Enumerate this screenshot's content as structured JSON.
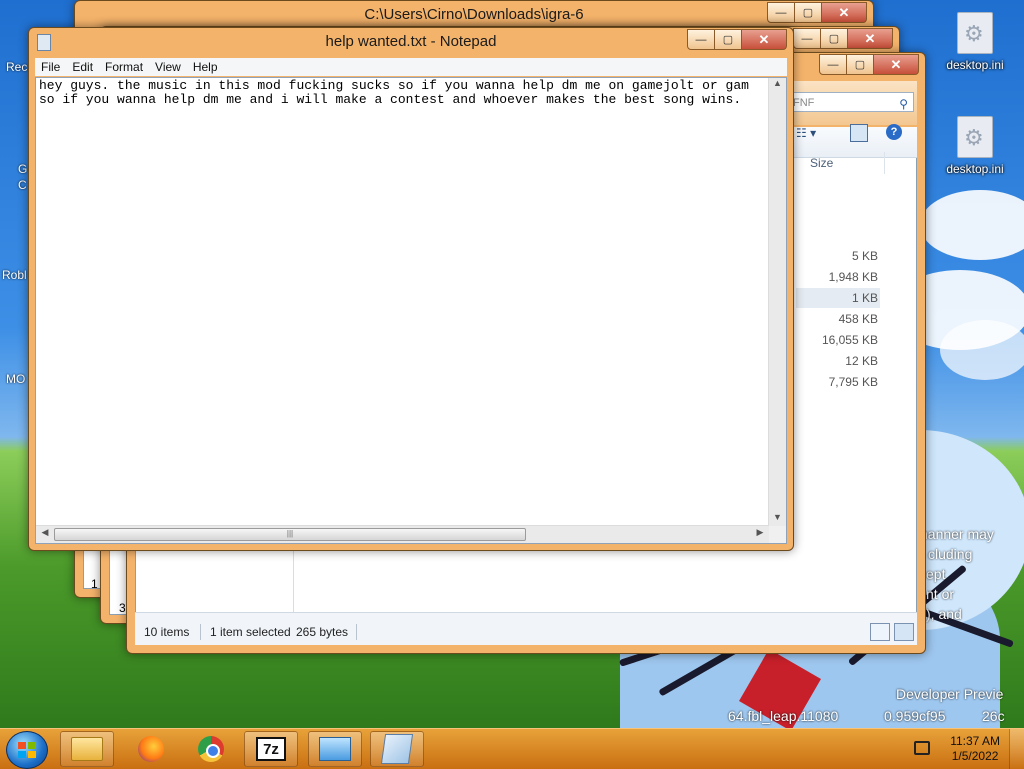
{
  "desktop": {
    "icons": [
      {
        "label": "desktop.ini"
      },
      {
        "label": "desktop.ini"
      }
    ],
    "left_partial_labels": [
      "Rec",
      "G",
      "C",
      "Robl",
      "MO"
    ],
    "watermark_lines": [
      "nanner may",
      "cluding",
      "ept",
      "nt or",
      "), and"
    ],
    "build_text_1": "Developer Previe",
    "build_text_2": "64.fbl_leap.11080",
    "build_text_3": "0.959cf95",
    "build_text_4": "26c"
  },
  "explorer_back": {
    "title": "C:\\Users\\Cirno\\Downloads\\igra-6",
    "left_counts": [
      "1",
      "3"
    ]
  },
  "explorer": {
    "search_placeholder": "FNF",
    "size_header": "Size",
    "sizes": [
      "5 KB",
      "1,948 KB",
      "1 KB",
      "458 KB",
      "16,055 KB",
      "12 KB",
      "7,795 KB"
    ],
    "status_items": "10 items",
    "status_selected": "1 item selected",
    "status_bytes": "265 bytes"
  },
  "notepad": {
    "title": "help wanted.txt - Notepad",
    "menu": [
      "File",
      "Edit",
      "Format",
      "View",
      "Help"
    ],
    "lines": [
      "hey guys. the music in this mod fucking sucks so if you wanna help dm me on gamejolt or gam",
      "so if you wanna help dm me and i will make a contest and whoever makes the best song wins."
    ]
  },
  "window_controls": {
    "minimize": "—",
    "maximize": "▢",
    "close": "✕"
  },
  "taskbar": {
    "time": "11:37 AM",
    "date": "1/5/2022",
    "seven_zip": "7z"
  },
  "colors": {
    "window_frame": "#f4b36b",
    "taskbar": "#d9891f",
    "sky": "#1f6fd0",
    "grass": "#4b9a2a"
  }
}
